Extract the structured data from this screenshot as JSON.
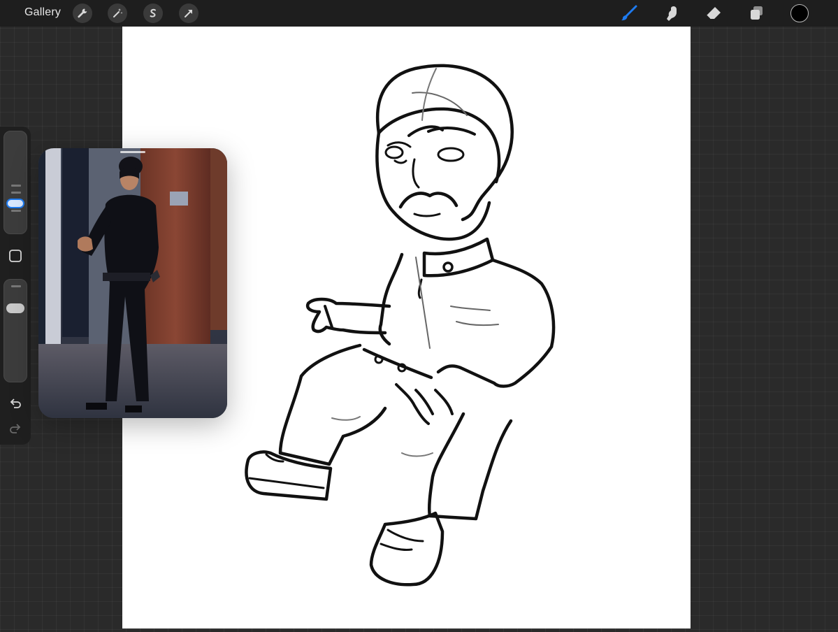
{
  "toolbar": {
    "gallery_label": "Gallery",
    "left_tools": [
      "wrench-icon",
      "magic-wand-icon",
      "selection-icon",
      "transform-arrow-icon"
    ],
    "right_tools": [
      "brush-icon",
      "smudge-icon",
      "eraser-icon",
      "layers-icon"
    ],
    "active_tool": "brush-icon",
    "active_color": "#1e7bf0",
    "current_color": "#000000"
  },
  "sidebar": {
    "brush_size_level": 0.28,
    "opacity_level": 0.72,
    "buttons": [
      "modify-square-icon",
      "undo-icon",
      "redo-icon"
    ]
  },
  "reference": {
    "description_icon": "reference-photo"
  }
}
